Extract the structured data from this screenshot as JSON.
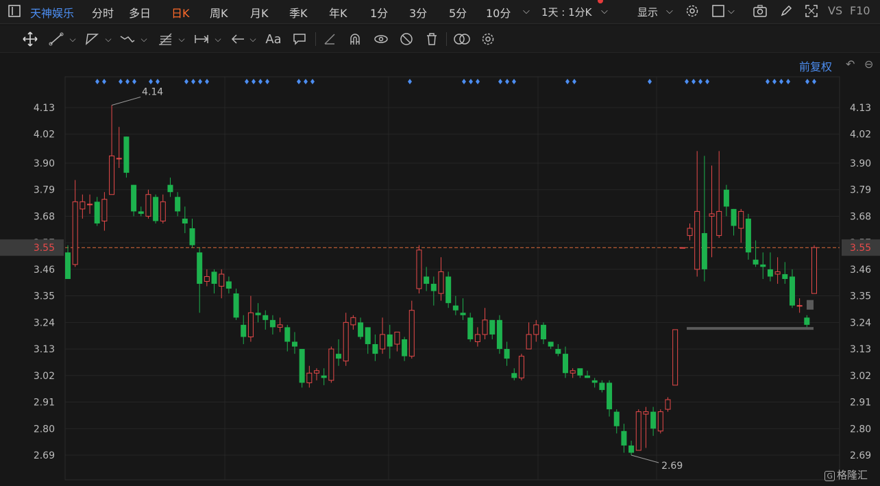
{
  "stock_name": "天神娱乐",
  "tabs": [
    "分时",
    "多日",
    "日K",
    "周K",
    "月K",
    "季K",
    "年K",
    "1分",
    "3分",
    "5分",
    "10分"
  ],
  "active_tab": "日K",
  "interval_selector": "1天 : 1分K",
  "display_label": "显示",
  "vs_label": "VS",
  "f10_label": "F10",
  "adjust_label": "前复权",
  "watermark": "格隆汇",
  "current_price_label": "3.55",
  "colors": {
    "up": "#e84a4a",
    "down": "#1db24e",
    "accent": "#4c8df0",
    "active_tab": "#ff6a2a",
    "price_line": "#e06b3a"
  },
  "icons": [
    "sidebar-toggle-icon",
    "more-chevron-icon",
    "settings-gear-icon",
    "window-icon",
    "camera-icon",
    "pen-icon",
    "fullscreen-icon",
    "move-icon",
    "line-draw-icon",
    "polygon-icon",
    "wave-icon",
    "fib-icon",
    "measure-icon",
    "arrow-icon",
    "text-icon",
    "comment-icon",
    "angle-icon",
    "magnet-icon",
    "eye-icon",
    "hide-icon",
    "trash-icon",
    "compare-icon",
    "tool-settings-icon",
    "undo-icon",
    "minus-icon"
  ],
  "chart_data": {
    "type": "candlestick",
    "y_ticks": [
      "4.13",
      "4.02",
      "3.90",
      "3.79",
      "3.68",
      "3.57",
      "3.46",
      "3.35",
      "3.24",
      "3.13",
      "3.02",
      "2.91",
      "2.80",
      "2.69"
    ],
    "ylim": [
      2.64,
      4.2
    ],
    "current_price": 3.55,
    "high_label": "4.14",
    "low_label": "2.69",
    "candles": [
      [
        3.53,
        3.42,
        3.56,
        3.42
      ],
      [
        3.48,
        3.74,
        3.83,
        3.47
      ],
      [
        3.71,
        3.74,
        3.77,
        3.67
      ],
      [
        3.73,
        3.73,
        3.77,
        3.69
      ],
      [
        3.74,
        3.65,
        3.76,
        3.64
      ],
      [
        3.66,
        3.75,
        3.78,
        3.62
      ],
      [
        3.77,
        3.93,
        4.14,
        3.77
      ],
      [
        3.92,
        3.92,
        4.05,
        3.88
      ],
      [
        4.01,
        3.86,
        4.01,
        3.84
      ],
      [
        3.81,
        3.7,
        3.81,
        3.68
      ],
      [
        3.7,
        3.69,
        3.72,
        3.68
      ],
      [
        3.68,
        3.77,
        3.79,
        3.67
      ],
      [
        3.76,
        3.66,
        3.77,
        3.65
      ],
      [
        3.66,
        3.74,
        3.77,
        3.65
      ],
      [
        3.81,
        3.78,
        3.84,
        3.76
      ],
      [
        3.76,
        3.7,
        3.78,
        3.68
      ],
      [
        3.67,
        3.65,
        3.72,
        3.61
      ],
      [
        3.63,
        3.56,
        3.67,
        3.55
      ],
      [
        3.53,
        3.4,
        3.55,
        3.28
      ],
      [
        3.41,
        3.43,
        3.46,
        3.39
      ],
      [
        3.45,
        3.4,
        3.46,
        3.36
      ],
      [
        3.39,
        3.44,
        3.46,
        3.34
      ],
      [
        3.41,
        3.38,
        3.43,
        3.36
      ],
      [
        3.36,
        3.26,
        3.38,
        3.25
      ],
      [
        3.23,
        3.18,
        3.27,
        3.15
      ],
      [
        3.18,
        3.28,
        3.35,
        3.16
      ],
      [
        3.28,
        3.27,
        3.32,
        3.24
      ],
      [
        3.27,
        3.25,
        3.29,
        3.21
      ],
      [
        3.25,
        3.22,
        3.27,
        3.19
      ],
      [
        3.22,
        3.23,
        3.26,
        3.2
      ],
      [
        3.22,
        3.16,
        3.23,
        3.12
      ],
      [
        3.16,
        3.14,
        3.2,
        3.11
      ],
      [
        3.13,
        2.99,
        3.13,
        2.97
      ],
      [
        2.99,
        3.03,
        3.06,
        2.97
      ],
      [
        3.03,
        3.04,
        3.05,
        3.0
      ],
      [
        3.02,
        3.01,
        3.05,
        2.98
      ],
      [
        3.0,
        3.13,
        3.14,
        2.99
      ],
      [
        3.11,
        3.09,
        3.17,
        3.06
      ],
      [
        3.08,
        3.24,
        3.28,
        3.06
      ],
      [
        3.23,
        3.26,
        3.27,
        3.21
      ],
      [
        3.24,
        3.18,
        3.26,
        3.17
      ],
      [
        3.22,
        3.15,
        3.22,
        3.11
      ],
      [
        3.15,
        3.11,
        3.19,
        3.08
      ],
      [
        3.13,
        3.19,
        3.26,
        3.11
      ],
      [
        3.19,
        3.14,
        3.23,
        3.09
      ],
      [
        3.15,
        3.2,
        3.2,
        3.12
      ],
      [
        3.17,
        3.1,
        3.18,
        3.08
      ],
      [
        3.1,
        3.29,
        3.33,
        3.09
      ],
      [
        3.38,
        3.54,
        3.56,
        3.36
      ],
      [
        3.43,
        3.4,
        3.47,
        3.37
      ],
      [
        3.4,
        3.37,
        3.43,
        3.31
      ],
      [
        3.36,
        3.45,
        3.51,
        3.33
      ],
      [
        3.43,
        3.32,
        3.45,
        3.3
      ],
      [
        3.31,
        3.29,
        3.35,
        3.27
      ],
      [
        3.28,
        3.27,
        3.34,
        3.25
      ],
      [
        3.26,
        3.17,
        3.28,
        3.16
      ],
      [
        3.16,
        3.19,
        3.22,
        3.14
      ],
      [
        3.19,
        3.25,
        3.3,
        3.17
      ],
      [
        3.25,
        3.19,
        3.25,
        3.17
      ],
      [
        3.25,
        3.13,
        3.27,
        3.11
      ],
      [
        3.13,
        3.09,
        3.16,
        3.06
      ],
      [
        3.03,
        3.01,
        3.05,
        3.0
      ],
      [
        3.01,
        3.1,
        3.11,
        3.0
      ],
      [
        3.13,
        3.19,
        3.24,
        3.13
      ],
      [
        3.19,
        3.23,
        3.25,
        3.16
      ],
      [
        3.23,
        3.17,
        3.24,
        3.15
      ],
      [
        3.16,
        3.14,
        3.16,
        3.13
      ],
      [
        3.13,
        3.11,
        3.15,
        3.1
      ],
      [
        3.11,
        3.03,
        3.14,
        3.01
      ],
      [
        3.03,
        3.04,
        3.05,
        3.01
      ],
      [
        3.05,
        3.02,
        3.04,
        3.01
      ],
      [
        3.02,
        3.01,
        3.04,
        3.01
      ],
      [
        3.0,
        2.99,
        3.01,
        2.97
      ],
      [
        2.99,
        2.96,
        3.0,
        2.95
      ],
      [
        2.99,
        2.88,
        3.0,
        2.85
      ],
      [
        2.87,
        2.81,
        2.88,
        2.78
      ],
      [
        2.79,
        2.73,
        2.82,
        2.7
      ],
      [
        2.73,
        2.7,
        2.75,
        2.69
      ],
      [
        2.71,
        2.87,
        2.88,
        2.71
      ],
      [
        2.86,
        2.87,
        2.89,
        2.72
      ],
      [
        2.87,
        2.8,
        2.89,
        2.77
      ],
      [
        2.79,
        2.87,
        2.88,
        2.78
      ],
      [
        2.88,
        2.92,
        2.93,
        2.87
      ],
      [
        2.98,
        3.21,
        3.21,
        2.98
      ],
      [
        3.55,
        3.55,
        3.55,
        3.55
      ],
      [
        3.6,
        3.63,
        3.65,
        3.58
      ],
      [
        3.46,
        3.7,
        3.95,
        3.43
      ],
      [
        3.61,
        3.46,
        3.93,
        3.41
      ],
      [
        3.68,
        3.69,
        3.89,
        3.51
      ],
      [
        3.6,
        3.7,
        3.95,
        3.59
      ],
      [
        3.79,
        3.72,
        3.81,
        3.68
      ],
      [
        3.71,
        3.64,
        3.71,
        3.6
      ],
      [
        3.63,
        3.7,
        3.71,
        3.57
      ],
      [
        3.67,
        3.53,
        3.69,
        3.5
      ],
      [
        3.5,
        3.48,
        3.58,
        3.47
      ],
      [
        3.48,
        3.47,
        3.53,
        3.42
      ],
      [
        3.46,
        3.43,
        3.53,
        3.41
      ],
      [
        3.44,
        3.45,
        3.51,
        3.4
      ],
      [
        3.44,
        3.42,
        3.49,
        3.4
      ],
      [
        3.43,
        3.31,
        3.46,
        3.3
      ],
      [
        3.31,
        3.31,
        3.34,
        3.28
      ],
      [
        3.26,
        3.23,
        3.27,
        3.22
      ],
      [
        3.36,
        3.55,
        3.56,
        3.36
      ]
    ],
    "marker_groups": [
      2,
      3,
      2,
      4,
      4,
      3,
      1,
      3,
      3,
      2,
      1,
      4,
      4,
      2
    ]
  }
}
